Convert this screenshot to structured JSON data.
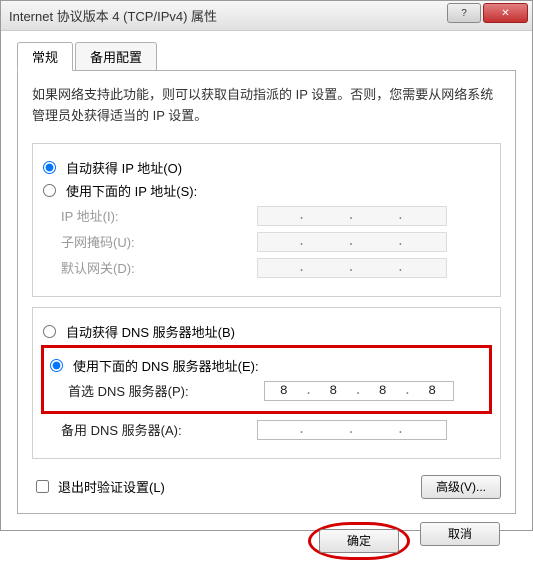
{
  "window": {
    "title": "Internet 协议版本 4 (TCP/IPv4) 属性"
  },
  "tabs": {
    "general": "常规",
    "alternate": "备用配置"
  },
  "description": "如果网络支持此功能，则可以获取自动指派的 IP 设置。否则，您需要从网络系统管理员处获得适当的 IP 设置。",
  "ip_section": {
    "auto_label": "自动获得 IP 地址(O)",
    "manual_label": "使用下面的 IP 地址(S):",
    "ip_label": "IP 地址(I):",
    "mask_label": "子网掩码(U):",
    "gateway_label": "默认网关(D):"
  },
  "dns_section": {
    "auto_label": "自动获得 DNS 服务器地址(B)",
    "manual_label": "使用下面的 DNS 服务器地址(E):",
    "preferred_label": "首选 DNS 服务器(P):",
    "preferred_value": [
      "8",
      "8",
      "8",
      "8"
    ],
    "alternate_label": "备用 DNS 服务器(A):"
  },
  "validate_label": "退出时验证设置(L)",
  "advanced_button": "高级(V)...",
  "ok_button": "确定",
  "cancel_button": "取消"
}
